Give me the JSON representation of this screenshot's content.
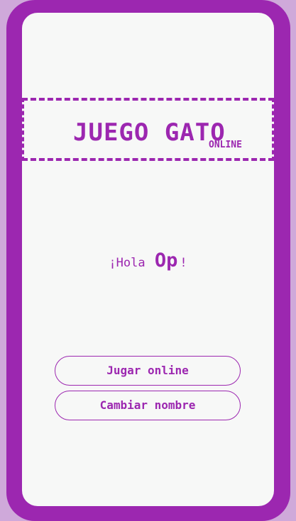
{
  "header": {
    "title": "JUEGO GATO",
    "subtitle": "ONLINE"
  },
  "greeting": {
    "prefix": "¡Hola",
    "name": "Op",
    "suffix": "!"
  },
  "buttons": {
    "play_online": "Jugar online",
    "change_name": "Cambiar nombre"
  },
  "colors": {
    "accent": "#9c27b0",
    "outer_background": "#cfa9da",
    "screen_background": "#f7f8f7"
  }
}
